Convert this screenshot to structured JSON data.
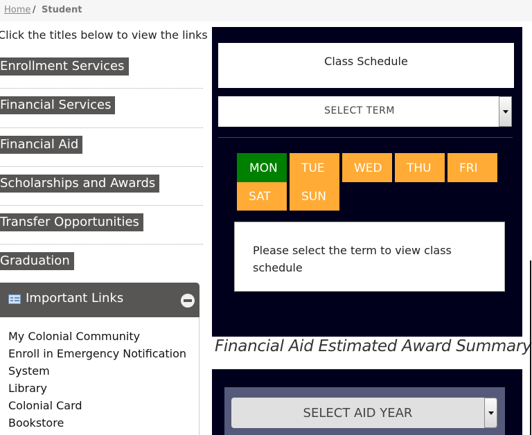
{
  "breadcrumb": {
    "home": "Home",
    "separator": "/",
    "current": "Student"
  },
  "sidebar": {
    "instructions": "Click the titles below to view the links",
    "categories": [
      {
        "label": "Enrollment Services"
      },
      {
        "label": "Financial Services"
      },
      {
        "label": "Financial Aid"
      },
      {
        "label": "Scholarships and Awards"
      },
      {
        "label": "Transfer Opportunities"
      },
      {
        "label": "Graduation"
      }
    ],
    "important_links": {
      "title": "Important Links",
      "icon": "list-card-icon",
      "collapse_icon": "minus-circle-icon",
      "items": [
        {
          "label": "My Colonial Community"
        },
        {
          "label": "Enroll in Emergency Notification"
        },
        {
          "label": "System"
        },
        {
          "label": "Library"
        },
        {
          "label": "Colonial Card"
        },
        {
          "label": "Bookstore"
        }
      ]
    }
  },
  "class_schedule": {
    "title": "Class Schedule",
    "term_select": {
      "value": "SELECT TERM"
    },
    "days": [
      {
        "label": "MON",
        "selected": true
      },
      {
        "label": "TUE",
        "selected": false
      },
      {
        "label": "WED",
        "selected": false
      },
      {
        "label": "THU",
        "selected": false
      },
      {
        "label": "FRI",
        "selected": false
      },
      {
        "label": "SAT",
        "selected": false
      },
      {
        "label": "SUN",
        "selected": false
      }
    ],
    "message": "Please select the term to view class schedule",
    "colors": {
      "selected": "#008000",
      "unselected": "#ffab35",
      "panel": "#00001c"
    }
  },
  "financial_aid": {
    "heading": "Financial Aid Estimated Award Summary",
    "aid_year_select": {
      "value": "SELECT AID YEAR"
    }
  }
}
